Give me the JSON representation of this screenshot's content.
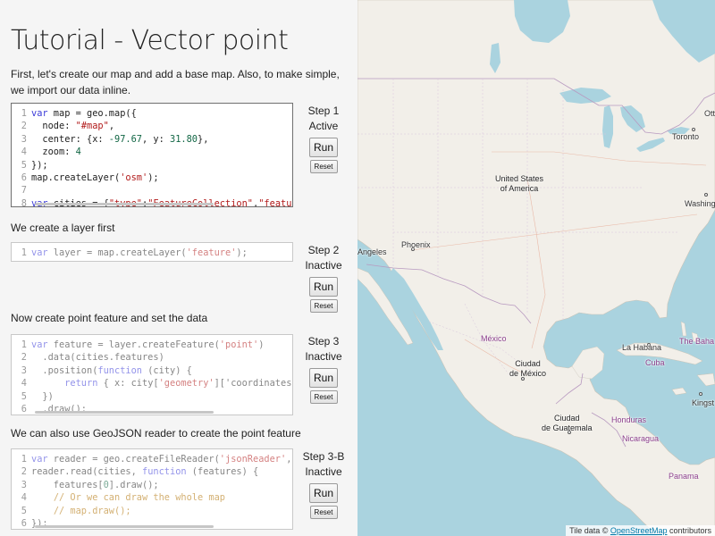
{
  "tutorial": {
    "title": "Tutorial - Vector point",
    "intro": "First, let's create our map and add a base map. Also, to make simple, we import our data inline.",
    "steps": [
      {
        "label": "Step 1",
        "status": "Active",
        "run_label": "Run",
        "reset_label": "Reset",
        "code": [
          "var map = geo.map({",
          "  node: \"#map\",",
          "  center: {x: -97.67, y: 31.80},",
          "  zoom: 4",
          "});",
          "map.createLayer('osm');",
          "",
          "var cities = {\"type\":\"FeatureCollection\",\"features\":"
        ]
      },
      {
        "description": "We create a layer first",
        "label": "Step 2",
        "status": "Inactive",
        "run_label": "Run",
        "reset_label": "Reset",
        "code": [
          "var layer = map.createLayer('feature');"
        ]
      },
      {
        "description": "Now create point feature and set the data",
        "label": "Step 3",
        "status": "Inactive",
        "run_label": "Run",
        "reset_label": "Reset",
        "code": [
          "var feature = layer.createFeature('point')",
          "  .data(cities.features)",
          "  .position(function (city) {",
          "      return { x: city['geometry']['coordinates",
          "  })",
          "  .draw();"
        ]
      },
      {
        "description": "We can also use GeoJSON reader to create the point feature",
        "label": "Step 3-B",
        "status": "Inactive",
        "run_label": "Run",
        "reset_label": "Reset",
        "code": [
          "var reader = geo.createFileReader('jsonReader',",
          "reader.read(cities, function (features) {",
          "    features[0].draw();",
          "    // Or we can draw the whole map",
          "    // map.draw();",
          "});"
        ]
      }
    ]
  },
  "map": {
    "labels": {
      "ottawa": "Otta",
      "toronto": "Toronto",
      "usa_line1": "United States",
      "usa_line2": "of America",
      "washington": "Washing",
      "los_angeles": "Angeles",
      "phoenix": "Phoenix",
      "la_habana": "La Habana",
      "bahamas": "The Baha",
      "cuba": "Cuba",
      "mexico": "México",
      "mexico_city_line1": "Ciudad",
      "mexico_city_line2": "de México",
      "kingston": "Kingst",
      "guatemala_line1": "Ciudad",
      "guatemala_line2": "de Guatemala",
      "honduras": "Honduras",
      "nicaragua": "Nicaragua",
      "panama": "Panama"
    },
    "attribution_prefix": "Tile data © ",
    "attribution_link": "OpenStreetMap",
    "attribution_suffix": " contributors",
    "colors": {
      "water": "#aad3df",
      "land": "#f2efe9",
      "border": "#b89ac0",
      "lake": "#aad3df"
    }
  }
}
